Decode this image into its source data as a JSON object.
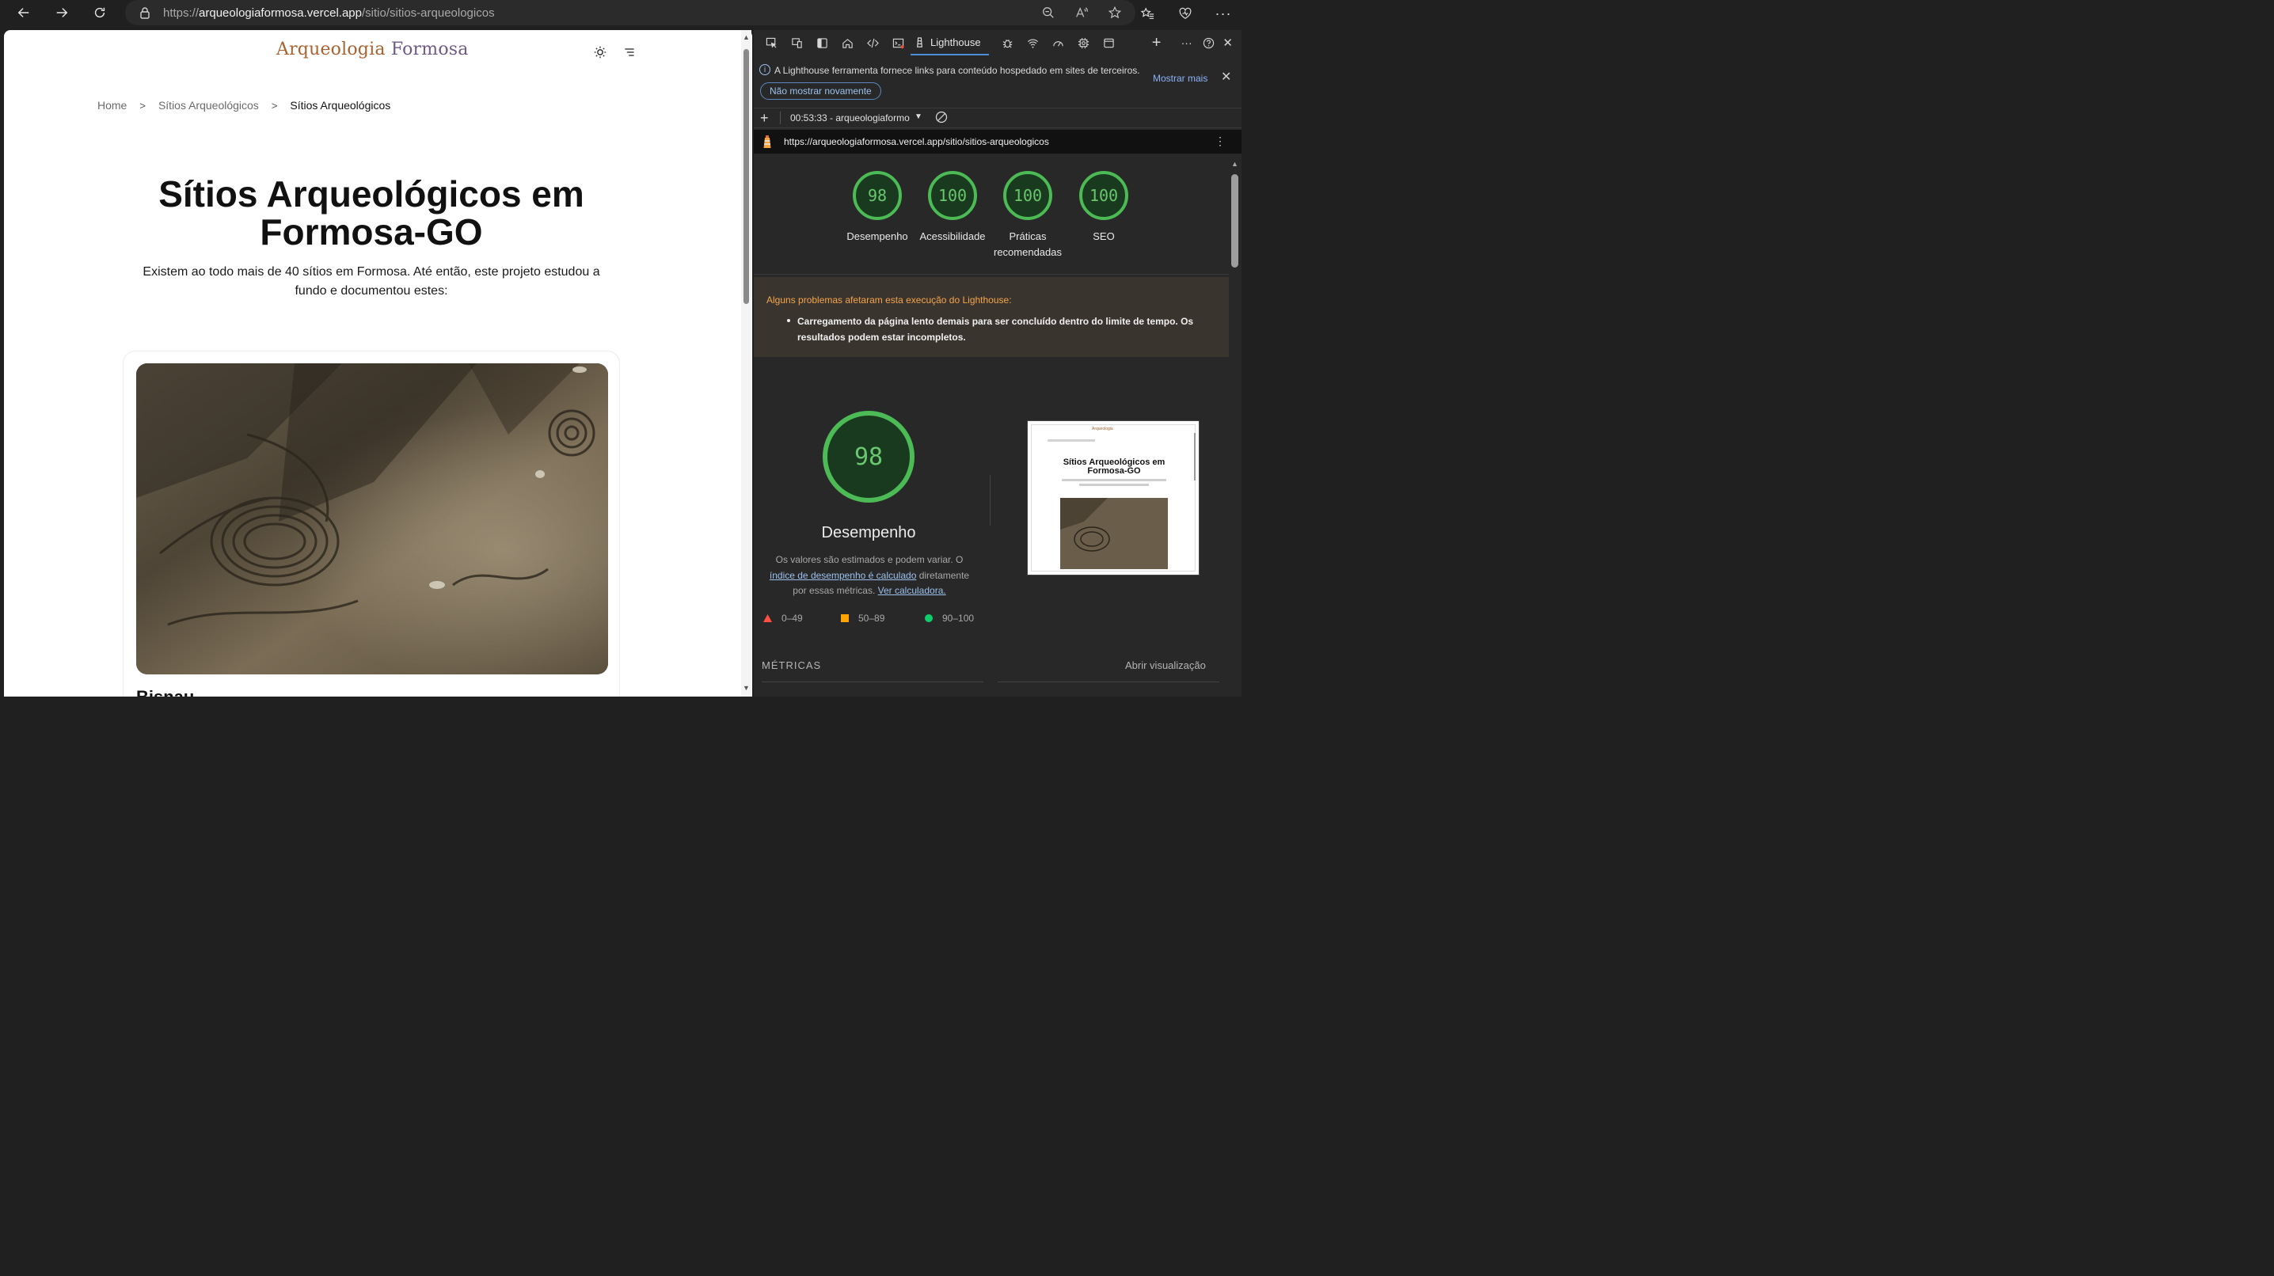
{
  "browser": {
    "url_prefix": "https://",
    "url_host": "arqueologiaformosa.vercel.app",
    "url_path": "/sitio/sitios-arqueologicos"
  },
  "site": {
    "logo_part1": "Arqueologia",
    "logo_part2": "Formosa",
    "breadcrumb": [
      "Home",
      "Sítios Arqueológicos",
      "Sítios Arqueológicos"
    ],
    "title": "Sítios Arqueológicos em Formosa-GO",
    "lead": "Existem ao todo mais de 40 sítios em Formosa. Até então, este projeto estudou a fundo e documentou estes:",
    "card_title": "Bisnau"
  },
  "devtools": {
    "lighthouse_tab": "Lighthouse",
    "info_message": "A Lighthouse ferramenta fornece links para conteúdo hospedado em sites de terceiros.",
    "dont_show": "Não mostrar novamente",
    "learn_more": "Mostrar mais",
    "report_selector": "00:53:33 - arqueologiaformo",
    "report_url": "https://arqueologiaformosa.vercel.app/sitio/sitios-arqueologicos",
    "scores": [
      {
        "value": "98",
        "label": "Desempenho"
      },
      {
        "value": "100",
        "label": "Acessibilidade"
      },
      {
        "value": "100",
        "label": "Práticas recomendadas"
      },
      {
        "value": "100",
        "label": "SEO"
      }
    ],
    "warning_title": "Alguns problemas afetaram esta execução do Lighthouse:",
    "warning_item": "Carregamento da página lento demais para ser concluído dentro do limite de tempo. Os resultados podem estar incompletos.",
    "big_score": "98",
    "big_label": "Desempenho",
    "desc_1": "Os valores são estimados e podem variar. O",
    "desc_link": "índice de desempenho é calculado",
    "desc_2": "diretamente por essas métricas.",
    "desc_link2": "Ver calculadora.",
    "legend": [
      "0–49",
      "50–89",
      "90–100"
    ],
    "metrics_label": "MÉTRICAS",
    "open_view": "Abrir visualização",
    "thumb_title": "Sítios Arqueológicos em Formosa-GO"
  },
  "colors": {
    "pass": "#0cce6b",
    "gauge_ring": "#4cba55",
    "gauge_fill": "#193a1f",
    "fail": "#ff4e42",
    "average": "#ffa400"
  }
}
